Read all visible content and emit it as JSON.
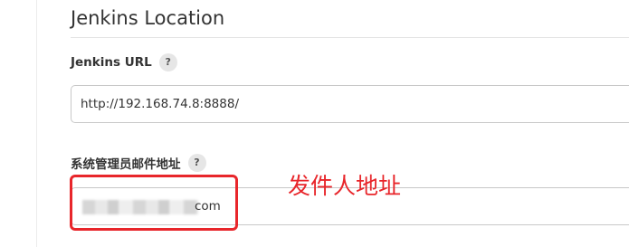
{
  "section": {
    "title": "Jenkins Location"
  },
  "url_field": {
    "label": "Jenkins URL",
    "help": "?",
    "value": "http://192.168.74.8:8888/"
  },
  "email_field": {
    "label": "系统管理员邮件地址",
    "help": "?",
    "value_visible_suffix": "com",
    "redacted": true
  },
  "annotation": {
    "text": "发件人地址",
    "color": "#e8262b"
  },
  "icons": {
    "help": "question-mark-icon"
  }
}
